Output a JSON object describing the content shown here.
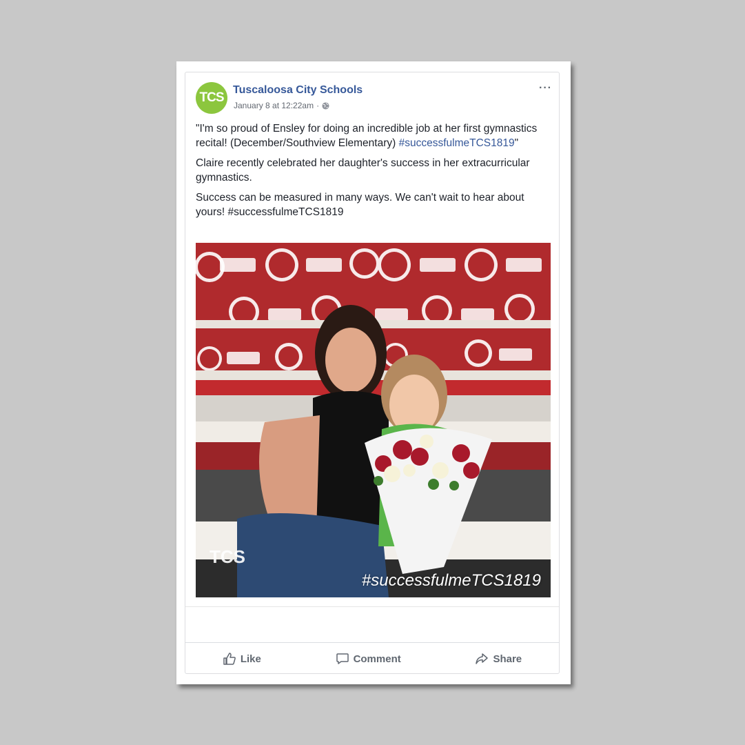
{
  "post": {
    "page_name": "Tuscaloosa City Schools",
    "avatar_text": "TCS",
    "timestamp": "January 8 at 12:22am",
    "meta_separator": "·",
    "more_icon": "···",
    "paragraphs": [
      {
        "text": "\"I'm so proud of Ensley for doing an incredible job at her first gymnastics recital! (December/Southview Elementary)",
        "hashtag": "#successfulmeTCS1819",
        "suffix": "\""
      },
      {
        "text": "Claire recently celebrated her daughter's success in her extracurricular gymnastics."
      },
      {
        "text": "Success can be measured in many ways. We can't wait to hear about yours! #successfulmeTCS1819"
      }
    ],
    "photo": {
      "watermark_text": "TCS",
      "hashtag_overlay": "#successfulmeTCS1819"
    }
  },
  "actions": {
    "like_label": "Like",
    "comment_label": "Comment",
    "share_label": "Share"
  },
  "colors": {
    "link_blue": "#365899",
    "avatar_green": "#8cc63e",
    "action_gray": "#606770"
  },
  "icons": [
    "globe-icon",
    "more-icon",
    "like-icon",
    "comment-icon",
    "share-icon"
  ]
}
